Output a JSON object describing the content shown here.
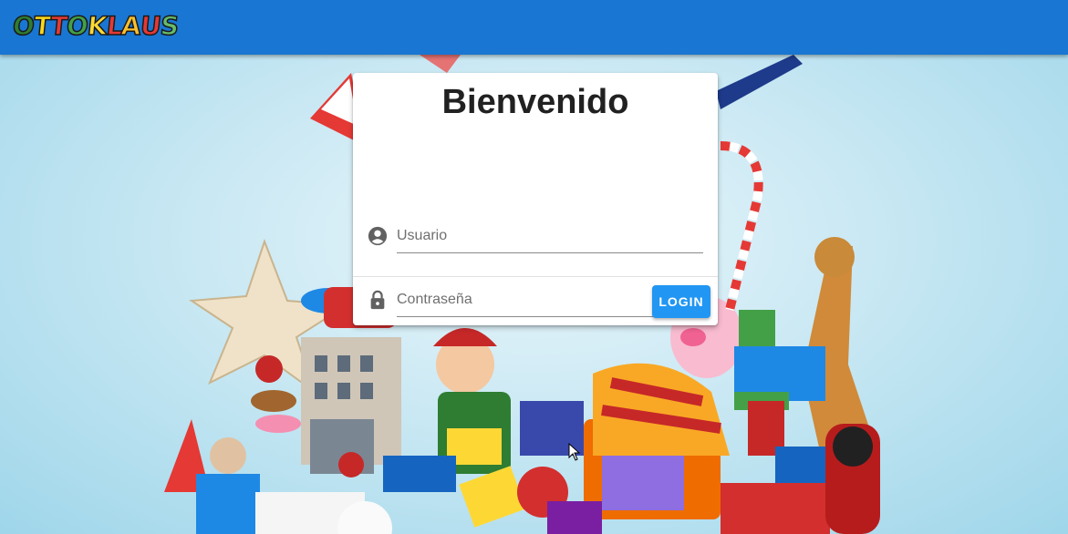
{
  "appbar": {
    "logo_letters": [
      {
        "char": "O",
        "color": "#2e7d32"
      },
      {
        "char": "T",
        "color": "#f9d71c"
      },
      {
        "char": "T",
        "color": "#e53935"
      },
      {
        "char": "O",
        "color": "#43a047"
      },
      {
        "char": "K",
        "color": "#fdd835"
      },
      {
        "char": "L",
        "color": "#e53935"
      },
      {
        "char": "A",
        "color": "#fbc02d"
      },
      {
        "char": "U",
        "color": "#e53935"
      },
      {
        "char": "S",
        "color": "#66bb6a"
      }
    ],
    "color": "#1976d2"
  },
  "login_card": {
    "title": "Bienvenido",
    "username": {
      "placeholder": "Usuario",
      "value": "",
      "icon": "account-circle-icon"
    },
    "password": {
      "placeholder": "Contraseña",
      "value": "",
      "icon": "lock-icon",
      "toggle_icon": "eye-off-icon"
    },
    "login_label": "LOGIN",
    "accent": "#2196f3"
  },
  "background": {
    "description_icon": "toy-pile-illustration"
  }
}
